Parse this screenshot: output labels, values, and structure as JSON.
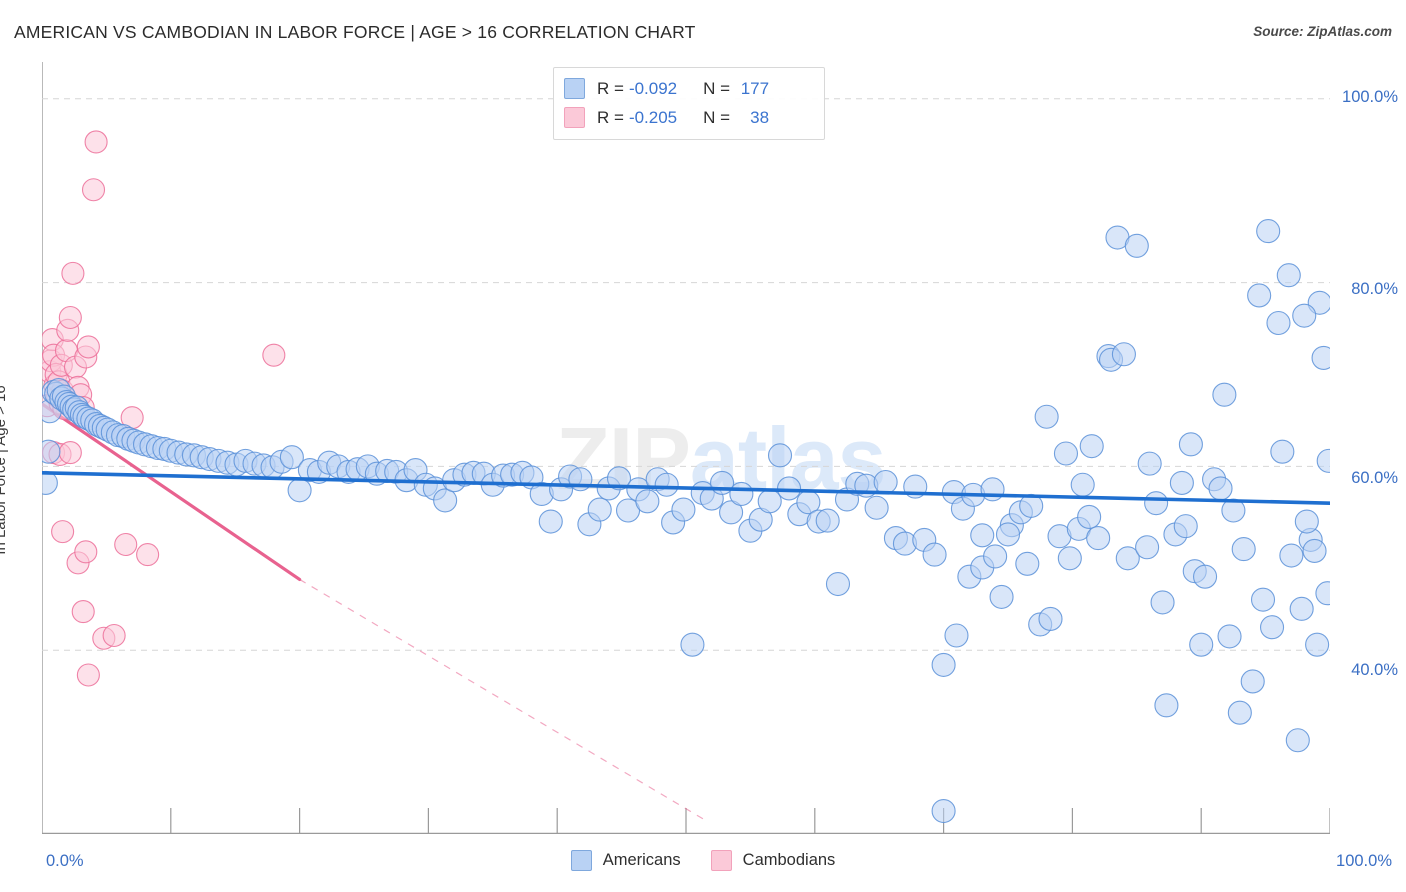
{
  "header": {
    "title": "AMERICAN VS CAMBODIAN IN LABOR FORCE | AGE > 16 CORRELATION CHART",
    "source": "Source: ZipAtlas.com"
  },
  "watermark": {
    "part1": "ZIP",
    "part2": "atlas"
  },
  "correlation_legend": {
    "rows": [
      {
        "series": "Americans",
        "r_label": "R =",
        "r_value": "-0.092",
        "n_label": "N =",
        "n_value": "177",
        "color": "#b9d2f4"
      },
      {
        "series": "Cambodians",
        "r_label": "R =",
        "r_value": "-0.205",
        "n_label": "N =",
        "n_value": "38",
        "color": "#fbc9d8"
      }
    ]
  },
  "series_legend": [
    {
      "label": "Americans",
      "color": "#b9d2f4",
      "border": "#7fa8dd"
    },
    {
      "label": "Cambodians",
      "color": "#fbc9d8",
      "border": "#f2a2bb"
    }
  ],
  "axes": {
    "y_title": "In Labor Force | Age > 16",
    "x_min_label": "0.0%",
    "x_max_label": "100.0%",
    "y_grid_labels": [
      "100.0%",
      "80.0%",
      "60.0%",
      "40.0%"
    ]
  },
  "chart_data": {
    "type": "scatter",
    "title": "AMERICAN VS CAMBODIAN IN LABOR FORCE | AGE > 16 CORRELATION CHART",
    "xlabel": "",
    "ylabel": "In Labor Force | Age > 16",
    "xlim": [
      0,
      100
    ],
    "ylim": [
      20,
      104
    ],
    "grid": true,
    "gridlines_y": [
      100,
      80,
      60,
      40
    ],
    "xticks": [
      0,
      10,
      20,
      30,
      40,
      50,
      60,
      70,
      80,
      90,
      100
    ],
    "legend_position": "bottom-center",
    "annotations": [
      "ZIPatlas watermark"
    ],
    "series": [
      {
        "name": "Americans",
        "color": "#b9d2f4",
        "border": "#5b91d8",
        "r": -0.092,
        "n": 177,
        "trendline": {
          "style": "solid",
          "color": "#1f6fd0",
          "x0": 0,
          "y0": 59.3,
          "x1": 100,
          "y1": 56.0
        },
        "points": [
          [
            0.3,
            58.2
          ],
          [
            0.5,
            61.6
          ],
          [
            0.6,
            66.0
          ],
          [
            0.9,
            68.1
          ],
          [
            1.1,
            67.9
          ],
          [
            1.3,
            68.3
          ],
          [
            1.5,
            67.4
          ],
          [
            1.7,
            67.6
          ],
          [
            1.9,
            67.0
          ],
          [
            2.1,
            66.8
          ],
          [
            2.3,
            66.5
          ],
          [
            2.5,
            66.2
          ],
          [
            2.7,
            66.4
          ],
          [
            2.9,
            65.9
          ],
          [
            3.1,
            65.6
          ],
          [
            3.3,
            65.4
          ],
          [
            3.6,
            65.2
          ],
          [
            3.9,
            65.0
          ],
          [
            4.2,
            64.6
          ],
          [
            4.5,
            64.4
          ],
          [
            4.8,
            64.2
          ],
          [
            5.1,
            64.0
          ],
          [
            5.5,
            63.7
          ],
          [
            5.9,
            63.4
          ],
          [
            6.3,
            63.3
          ],
          [
            6.7,
            63.0
          ],
          [
            7.1,
            62.8
          ],
          [
            7.5,
            62.6
          ],
          [
            8.0,
            62.4
          ],
          [
            8.5,
            62.2
          ],
          [
            9.0,
            62.0
          ],
          [
            9.5,
            61.9
          ],
          [
            10.0,
            61.7
          ],
          [
            10.6,
            61.5
          ],
          [
            11.2,
            61.3
          ],
          [
            11.8,
            61.2
          ],
          [
            12.4,
            61.0
          ],
          [
            13.0,
            60.8
          ],
          [
            13.7,
            60.6
          ],
          [
            14.4,
            60.4
          ],
          [
            15.1,
            60.2
          ],
          [
            15.8,
            60.6
          ],
          [
            16.5,
            60.3
          ],
          [
            17.2,
            60.1
          ],
          [
            17.9,
            59.9
          ],
          [
            18.6,
            60.5
          ],
          [
            19.4,
            61.0
          ],
          [
            20.0,
            57.4
          ],
          [
            20.8,
            59.6
          ],
          [
            21.5,
            59.4
          ],
          [
            22.3,
            60.4
          ],
          [
            23.0,
            60.0
          ],
          [
            23.8,
            59.4
          ],
          [
            24.5,
            59.7
          ],
          [
            25.3,
            60.0
          ],
          [
            26.0,
            59.2
          ],
          [
            26.8,
            59.5
          ],
          [
            27.5,
            59.4
          ],
          [
            28.3,
            58.5
          ],
          [
            29.0,
            59.6
          ],
          [
            29.8,
            58.0
          ],
          [
            30.5,
            57.6
          ],
          [
            31.3,
            56.3
          ],
          [
            32.0,
            58.5
          ],
          [
            32.8,
            59.1
          ],
          [
            33.5,
            59.3
          ],
          [
            34.3,
            59.2
          ],
          [
            35.0,
            58.0
          ],
          [
            35.8,
            59.0
          ],
          [
            36.5,
            59.1
          ],
          [
            37.3,
            59.3
          ],
          [
            38.0,
            58.8
          ],
          [
            38.8,
            57.0
          ],
          [
            39.5,
            54.0
          ],
          [
            40.3,
            57.5
          ],
          [
            41.0,
            58.9
          ],
          [
            41.8,
            58.6
          ],
          [
            42.5,
            53.7
          ],
          [
            43.3,
            55.3
          ],
          [
            44.0,
            57.6
          ],
          [
            44.8,
            58.7
          ],
          [
            45.5,
            55.2
          ],
          [
            46.3,
            57.5
          ],
          [
            47.0,
            56.2
          ],
          [
            47.8,
            58.6
          ],
          [
            48.5,
            58.0
          ],
          [
            49.0,
            53.9
          ],
          [
            49.8,
            55.3
          ],
          [
            50.5,
            40.6
          ],
          [
            51.3,
            57.1
          ],
          [
            52.0,
            56.5
          ],
          [
            52.8,
            58.2
          ],
          [
            53.5,
            55.0
          ],
          [
            54.3,
            57.0
          ],
          [
            55.0,
            53.0
          ],
          [
            55.8,
            54.2
          ],
          [
            56.5,
            56.2
          ],
          [
            57.3,
            61.2
          ],
          [
            58.0,
            57.6
          ],
          [
            58.8,
            54.8
          ],
          [
            59.5,
            56.1
          ],
          [
            60.3,
            54.0
          ],
          [
            61.0,
            54.1
          ],
          [
            61.8,
            47.2
          ],
          [
            62.5,
            56.4
          ],
          [
            63.3,
            58.1
          ],
          [
            64.0,
            57.9
          ],
          [
            64.8,
            55.5
          ],
          [
            65.5,
            58.3
          ],
          [
            66.3,
            52.2
          ],
          [
            67.0,
            51.6
          ],
          [
            67.8,
            57.8
          ],
          [
            68.5,
            52.0
          ],
          [
            69.3,
            50.4
          ],
          [
            70.0,
            22.5
          ],
          [
            70.8,
            57.2
          ],
          [
            71.5,
            55.4
          ],
          [
            72.3,
            56.9
          ],
          [
            73.0,
            52.5
          ],
          [
            73.8,
            57.5
          ],
          [
            74.5,
            45.8
          ],
          [
            75.3,
            53.6
          ],
          [
            76.0,
            55.0
          ],
          [
            76.8,
            55.7
          ],
          [
            77.5,
            42.8
          ],
          [
            78.3,
            43.4
          ],
          [
            79.0,
            52.4
          ],
          [
            79.8,
            50.0
          ],
          [
            80.5,
            53.2
          ],
          [
            81.3,
            54.5
          ],
          [
            82.0,
            52.2
          ],
          [
            82.8,
            72.0
          ],
          [
            83.5,
            84.9
          ],
          [
            84.3,
            50.0
          ],
          [
            85.0,
            84.0
          ],
          [
            85.8,
            51.2
          ],
          [
            86.5,
            56.0
          ],
          [
            87.3,
            34.0
          ],
          [
            88.0,
            52.6
          ],
          [
            88.8,
            53.5
          ],
          [
            89.5,
            48.6
          ],
          [
            90.3,
            48.0
          ],
          [
            91.0,
            58.6
          ],
          [
            91.8,
            67.8
          ],
          [
            92.5,
            55.2
          ],
          [
            93.3,
            51.0
          ],
          [
            94.0,
            36.6
          ],
          [
            94.8,
            45.5
          ],
          [
            95.5,
            42.5
          ],
          [
            96.3,
            61.6
          ],
          [
            97.0,
            50.3
          ],
          [
            97.8,
            44.5
          ],
          [
            98.5,
            52.0
          ],
          [
            99.0,
            40.6
          ],
          [
            99.8,
            46.2
          ],
          [
            70.0,
            38.4
          ],
          [
            71.0,
            41.6
          ],
          [
            72.0,
            48.0
          ],
          [
            73.0,
            49.0
          ],
          [
            74.0,
            50.2
          ],
          [
            75.0,
            52.6
          ],
          [
            76.5,
            49.4
          ],
          [
            78.0,
            65.4
          ],
          [
            79.5,
            61.4
          ],
          [
            80.8,
            58.0
          ],
          [
            81.5,
            62.2
          ],
          [
            83.0,
            71.6
          ],
          [
            84.0,
            72.2
          ],
          [
            86.0,
            60.3
          ],
          [
            87.0,
            45.2
          ],
          [
            88.5,
            58.2
          ],
          [
            89.2,
            62.4
          ],
          [
            90.0,
            40.6
          ],
          [
            91.5,
            57.6
          ],
          [
            92.2,
            41.5
          ],
          [
            93.0,
            33.2
          ],
          [
            94.5,
            78.6
          ],
          [
            95.2,
            85.6
          ],
          [
            96.0,
            75.6
          ],
          [
            96.8,
            80.8
          ],
          [
            97.5,
            30.2
          ],
          [
            98.2,
            54.0
          ],
          [
            98.8,
            50.8
          ],
          [
            99.5,
            71.8
          ],
          [
            99.9,
            60.6
          ],
          [
            99.2,
            77.8
          ],
          [
            98.0,
            76.4
          ]
        ]
      },
      {
        "name": "Cambodians",
        "color": "#fbc9d8",
        "border": "#ec6f99",
        "r": -0.205,
        "n": 38,
        "trendline": {
          "style": "solid-then-dashed",
          "color": "#e8628f",
          "x0": 0,
          "y0": 66.8,
          "x_solid_end": 20.0,
          "y_solid_end": 47.7,
          "x1": 51.5,
          "y1": 21.5
        },
        "points": [
          [
            0.4,
            66.6
          ],
          [
            0.6,
            70.3
          ],
          [
            0.7,
            71.5
          ],
          [
            0.8,
            73.8
          ],
          [
            0.9,
            72.1
          ],
          [
            1.0,
            68.8
          ],
          [
            1.1,
            70.0
          ],
          [
            1.2,
            67.6
          ],
          [
            1.3,
            69.2
          ],
          [
            1.4,
            66.9
          ],
          [
            1.5,
            71.0
          ],
          [
            1.6,
            68.2
          ],
          [
            1.7,
            66.3
          ],
          [
            1.8,
            67.2
          ],
          [
            1.9,
            72.6
          ],
          [
            2.0,
            74.8
          ],
          [
            2.2,
            76.2
          ],
          [
            2.4,
            81.0
          ],
          [
            2.6,
            70.8
          ],
          [
            2.8,
            68.6
          ],
          [
            3.0,
            67.8
          ],
          [
            3.2,
            66.4
          ],
          [
            3.4,
            71.9
          ],
          [
            3.6,
            73.0
          ],
          [
            4.0,
            90.1
          ],
          [
            4.2,
            95.3
          ],
          [
            0.9,
            61.5
          ],
          [
            1.4,
            61.3
          ],
          [
            2.2,
            61.5
          ],
          [
            1.6,
            52.9
          ],
          [
            2.8,
            49.5
          ],
          [
            3.4,
            50.7
          ],
          [
            6.5,
            51.5
          ],
          [
            8.2,
            50.4
          ],
          [
            3.2,
            44.2
          ],
          [
            4.8,
            41.3
          ],
          [
            5.6,
            41.6
          ],
          [
            3.6,
            37.3
          ],
          [
            18.0,
            72.1
          ],
          [
            7.0,
            65.3
          ]
        ]
      }
    ]
  }
}
